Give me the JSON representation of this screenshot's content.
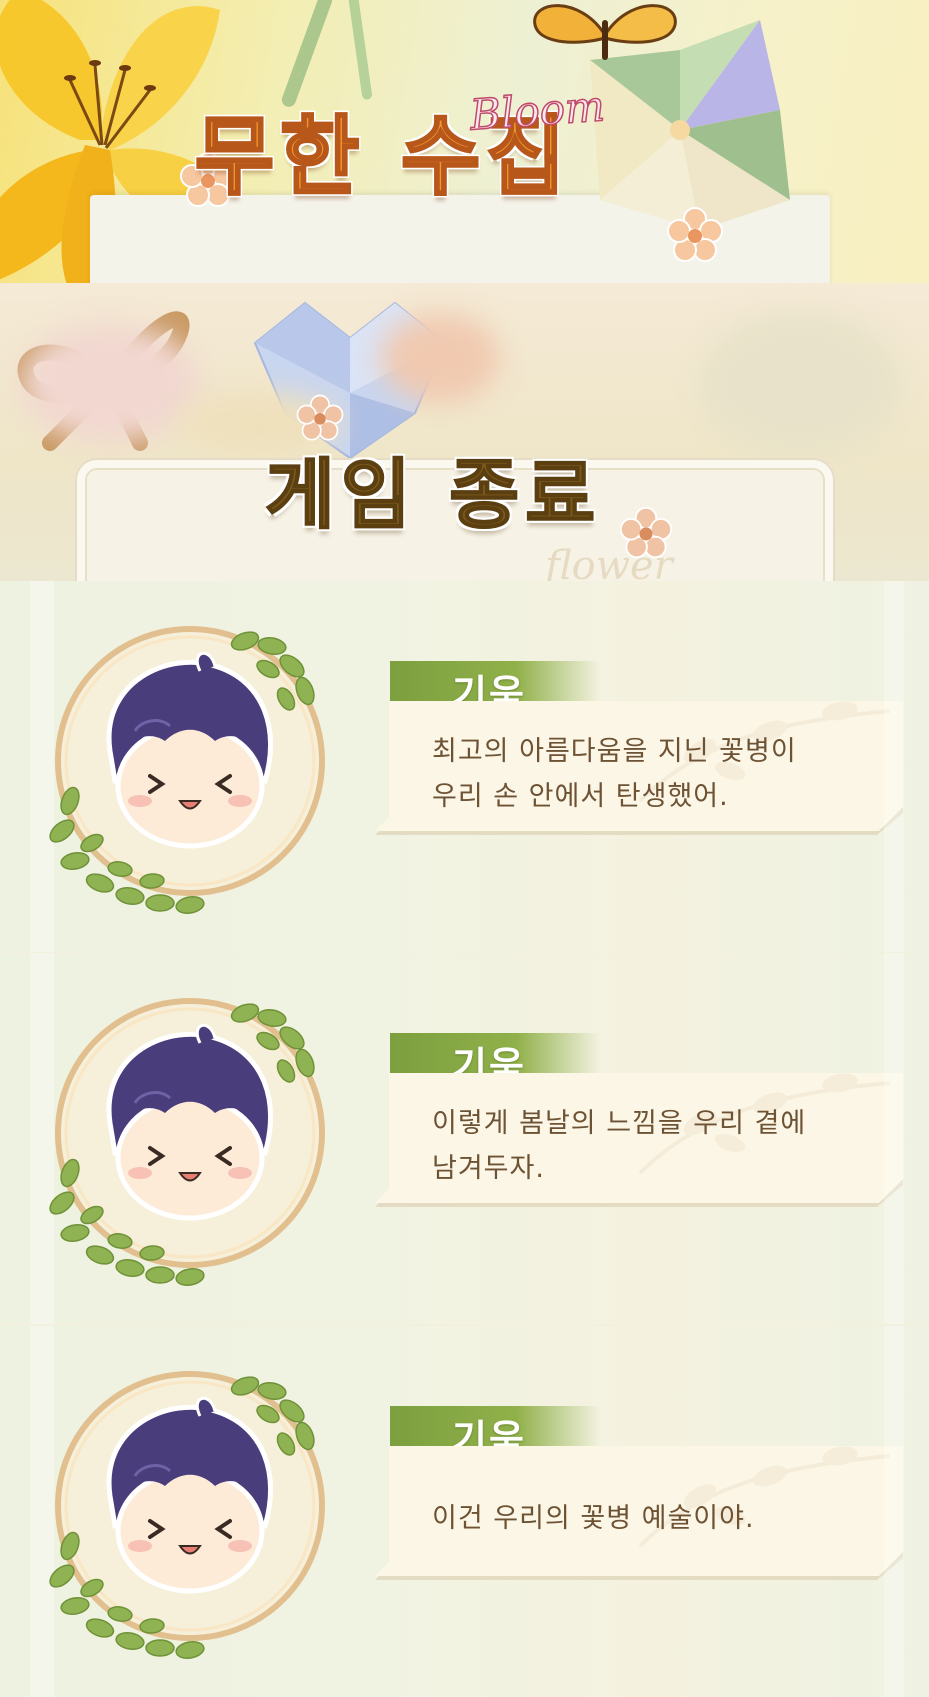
{
  "title": {
    "main": "무한 수집",
    "subtitle": "Bloom"
  },
  "game_over": {
    "label": "게임 종료",
    "card_script": "flower"
  },
  "dialogues": [
    {
      "speaker": "기욱",
      "lines": [
        "최고의 아름다움을 지닌 꽃병이",
        "우리 손 안에서 탄생했어."
      ]
    },
    {
      "speaker": "기욱",
      "lines": [
        "이렇게 봄날의 느낌을 우리 곁에",
        "남겨두자."
      ]
    },
    {
      "speaker": "기욱",
      "lines": [
        "이건 우리의 꽃병 예술이야."
      ]
    }
  ],
  "colors": {
    "title_orange": "#f2962f",
    "title_outline": "#b8571a",
    "over_brown": "#7a5a1c",
    "name_green": "#7c9f3f",
    "text_brown": "#6e5234",
    "hair_purple": "#4a3d7c"
  },
  "icons": [
    "lily-flower-icon",
    "butterfly-icon",
    "pinwheel-icon",
    "ribbon-bow-icon",
    "origami-heart-icon",
    "small-flower-icon",
    "leaf-wreath-icon",
    "character-avatar-icon"
  ]
}
